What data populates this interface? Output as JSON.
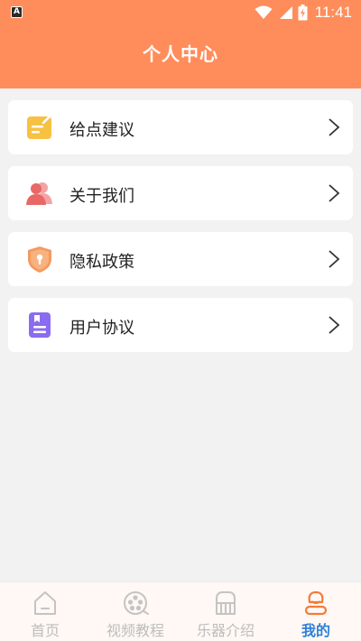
{
  "status_bar": {
    "time": "11:41",
    "app_badge": "A",
    "icons": [
      "wifi-icon",
      "cell-signal-icon",
      "battery-charging-icon"
    ]
  },
  "header": {
    "title": "个人中心",
    "background": "#ff8d5b"
  },
  "menu": [
    {
      "label": "给点建议",
      "icon": "feedback-note-icon",
      "color": "#f7c144"
    },
    {
      "label": "关于我们",
      "icon": "users-icon",
      "color": "#ec6f6f"
    },
    {
      "label": "隐私政策",
      "icon": "shield-lock-icon",
      "color": "#f39a5f"
    },
    {
      "label": "用户协议",
      "icon": "agreement-book-icon",
      "color": "#8b6cf0"
    }
  ],
  "tabbar": {
    "active_color": "#2f7fd9",
    "inactive_color": "#bdbdbd",
    "tabs": [
      {
        "label": "首页",
        "icon": "home-icon",
        "active": false
      },
      {
        "label": "视频教程",
        "icon": "film-reel-icon",
        "active": false
      },
      {
        "label": "乐器介绍",
        "icon": "piano-icon",
        "active": false
      },
      {
        "label": "我的",
        "icon": "profile-icon",
        "active": true
      }
    ]
  }
}
